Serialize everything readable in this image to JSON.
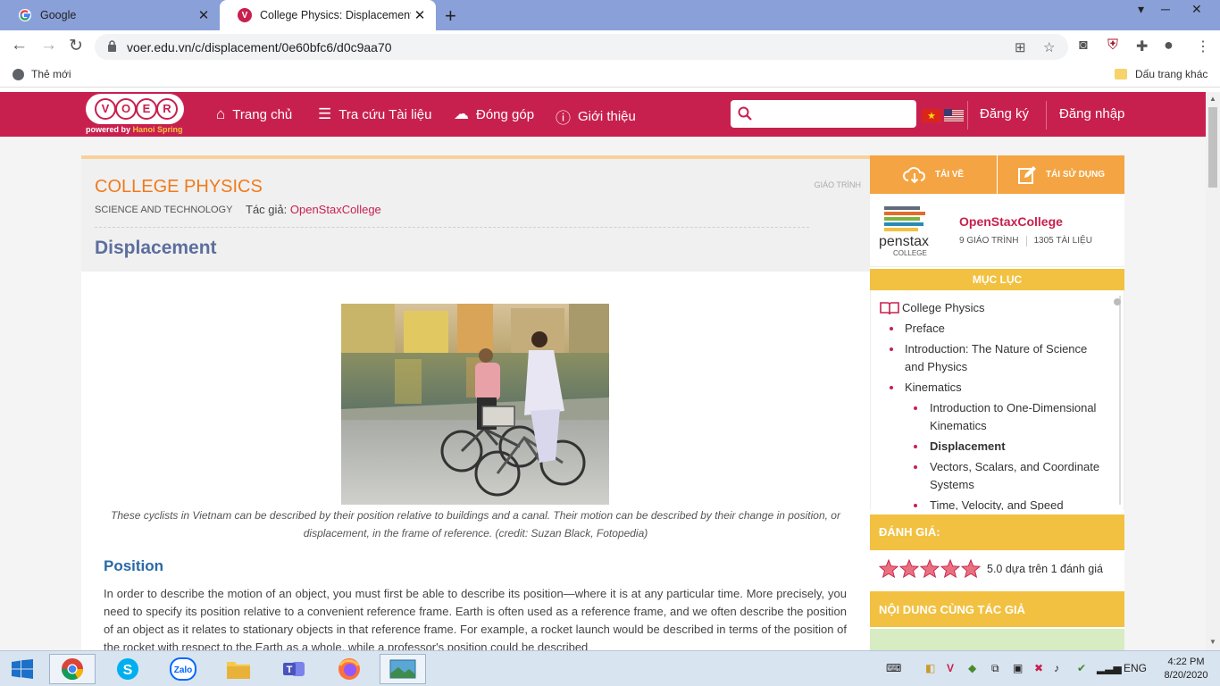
{
  "browser": {
    "tabs": [
      {
        "title": "Google",
        "favicon": "google-icon"
      },
      {
        "title": "College Physics: Displacement - V",
        "favicon": "voer-icon",
        "active": true
      }
    ],
    "url": "voer.edu.vn/c/displacement/0e60bfc6/d0c9aa70",
    "bookmarks": {
      "apps_label": "Thẻ mới",
      "other_label": "Dấu trang khác"
    }
  },
  "site": {
    "logo_letters": [
      "V",
      "O",
      "E",
      "R"
    ],
    "logo_powered": "powered by",
    "logo_brand": "Hanoi Spring",
    "nav": [
      {
        "label": "Trang chủ",
        "icon": "home-icon"
      },
      {
        "label": "Tra cứu Tài liệu",
        "icon": "list-icon"
      },
      {
        "label": "Đóng góp",
        "icon": "cloud-upload-icon"
      },
      {
        "label": "Giới thiệu",
        "icon": "info-icon"
      }
    ],
    "search_placeholder": "",
    "register": "Đăng ký",
    "login": "Đăng nhập"
  },
  "book": {
    "title": "COLLEGE PHYSICS",
    "type": "GIÁO TRÌNH",
    "subject": "SCIENCE AND TECHNOLOGY",
    "author_label": "Tác giả:",
    "author": "OpenStaxCollege"
  },
  "page": {
    "title": "Displacement",
    "caption": "These cyclists in Vietnam can be described by their position relative to buildings and a canal. Their motion can be described by their change in position, or displacement, in the frame of reference. (credit: Suzan Black, Fotopedia)",
    "section_heading": "Position",
    "paragraph": "In order to describe the motion of an object, you must first be able to describe its position—where it is at any particular time. More precisely, you need to specify its position relative to a convenient reference frame. Earth is often used as a reference frame, and we often describe the position of an object as it relates to stationary objects in that reference frame. For example, a rocket launch would be described in terms of the position of the rocket with respect to the Earth as a whole, while a professor's position could be described"
  },
  "sidebar": {
    "download": "TẢI VỀ",
    "reuse": "TÁI SỬ DỤNG",
    "author_name": "OpenStaxCollege",
    "author_books": "9 GIÁO TRÌNH",
    "author_docs": "1305 TÀI LIỆU",
    "toc_title": "MỤC LỤC",
    "toc": {
      "root": "College Physics",
      "preface": "Preface",
      "intro_line1": "Introduction: The Nature of Science",
      "intro_line2": "and Physics",
      "kinematics": "Kinematics",
      "intro1d_line1": "Introduction to One-Dimensional",
      "intro1d_line2": "Kinematics",
      "displacement": "Displacement",
      "vectors_line1": "Vectors, Scalars, and Coordinate",
      "vectors_line2": "Systems",
      "time_partial": "Time, Velocity, and Speed"
    },
    "rating_title": "ĐÁNH GIÁ:",
    "rating_value": 5.0,
    "rating_text": "5.0 dựa trên 1 đánh giá",
    "related_title": "NỘI DUNG CÙNG TÁC GIẢ"
  },
  "taskbar": {
    "apps": [
      "windows-start-icon",
      "chrome-icon",
      "skype-icon",
      "zalo-icon",
      "file-explorer-icon",
      "teams-icon",
      "firefox-icon",
      "photos-icon"
    ],
    "language": "ENG",
    "time": "4:22 PM",
    "date": "8/20/2020"
  },
  "colors": {
    "brand": "#c8204e",
    "accent_orange": "#f4a442",
    "accent_yellow": "#f2c141",
    "title_orange": "#f07b1c",
    "link_blue": "#2a6aa6"
  }
}
